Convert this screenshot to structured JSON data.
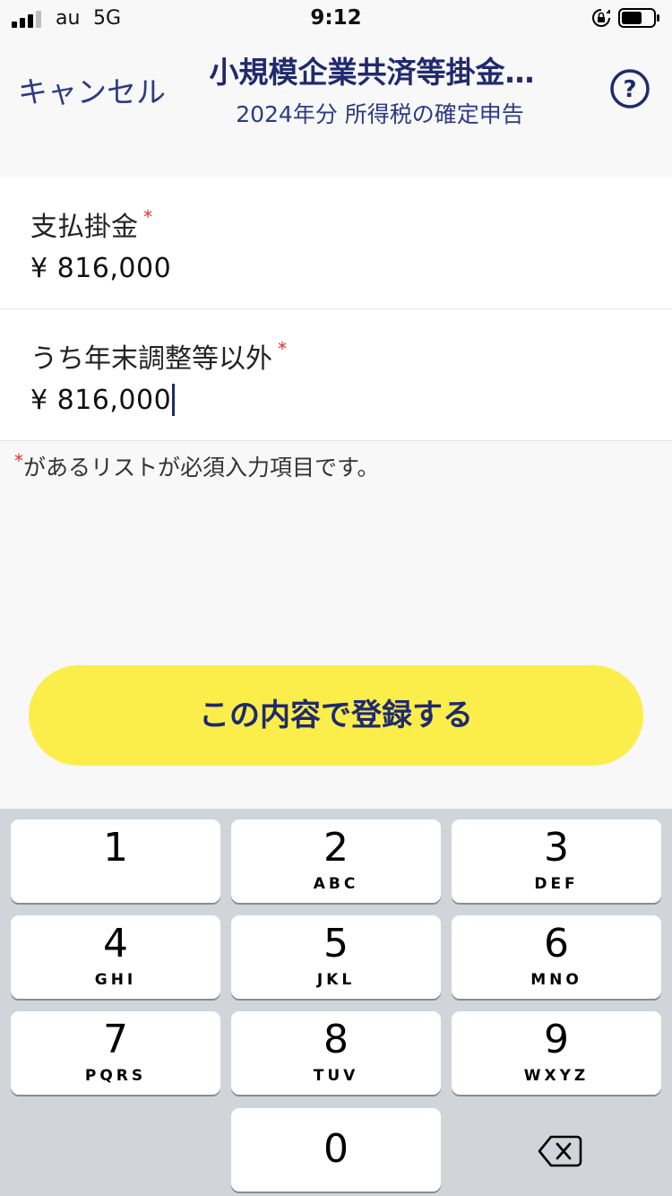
{
  "status_bar": {
    "carrier": "au",
    "network": "5G",
    "time": "9:12",
    "signal_bars_active": 3,
    "signal_bars_total": 4,
    "icons": [
      "signal-icon",
      "rotation-lock-icon",
      "battery-icon"
    ]
  },
  "nav": {
    "cancel_label": "キャンセル",
    "title": "小規模企業共済等掛金…",
    "subtitle": "2024年分 所得税の確定申告",
    "help_symbol": "?"
  },
  "form": {
    "fields": [
      {
        "label": "支払掛金",
        "required_mark": "*",
        "value": "¥ 816,000"
      },
      {
        "label": "うち年末調整等以外",
        "required_mark": "*",
        "value": "¥ 816,000"
      }
    ],
    "note_mark": "*",
    "note_text": "があるリストが必須入力項目です。"
  },
  "submit": {
    "label": "この内容で登録する"
  },
  "keyboard": {
    "keys": [
      {
        "num": "1",
        "letters": ""
      },
      {
        "num": "2",
        "letters": "ABC"
      },
      {
        "num": "3",
        "letters": "DEF"
      },
      {
        "num": "4",
        "letters": "GHI"
      },
      {
        "num": "5",
        "letters": "JKL"
      },
      {
        "num": "6",
        "letters": "MNO"
      },
      {
        "num": "7",
        "letters": "PQRS"
      },
      {
        "num": "8",
        "letters": "TUV"
      },
      {
        "num": "9",
        "letters": "WXYZ"
      },
      {
        "num": "0",
        "letters": ""
      }
    ],
    "backspace_icon": "backspace-icon"
  },
  "colors": {
    "accent": "#1f2a6e",
    "button": "#fcee4a",
    "required": "#e03030",
    "keyboard_bg": "#d1d4d9"
  }
}
